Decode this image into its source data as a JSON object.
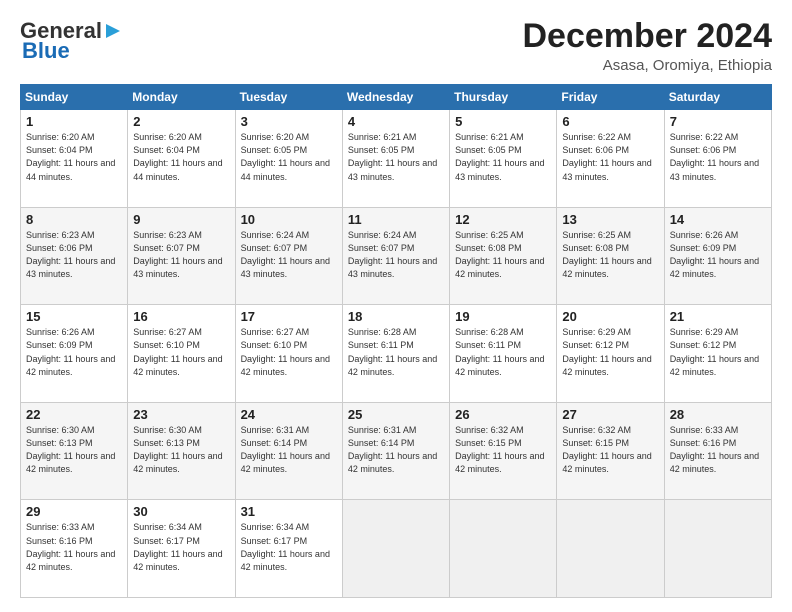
{
  "header": {
    "logo_line1": "General",
    "logo_line2": "Blue",
    "month": "December 2024",
    "location": "Asasa, Oromiya, Ethiopia"
  },
  "days_of_week": [
    "Sunday",
    "Monday",
    "Tuesday",
    "Wednesday",
    "Thursday",
    "Friday",
    "Saturday"
  ],
  "weeks": [
    [
      {
        "day": "1",
        "sunrise": "6:20 AM",
        "sunset": "6:04 PM",
        "daylight": "11 hours and 44 minutes."
      },
      {
        "day": "2",
        "sunrise": "6:20 AM",
        "sunset": "6:04 PM",
        "daylight": "11 hours and 44 minutes."
      },
      {
        "day": "3",
        "sunrise": "6:20 AM",
        "sunset": "6:05 PM",
        "daylight": "11 hours and 44 minutes."
      },
      {
        "day": "4",
        "sunrise": "6:21 AM",
        "sunset": "6:05 PM",
        "daylight": "11 hours and 43 minutes."
      },
      {
        "day": "5",
        "sunrise": "6:21 AM",
        "sunset": "6:05 PM",
        "daylight": "11 hours and 43 minutes."
      },
      {
        "day": "6",
        "sunrise": "6:22 AM",
        "sunset": "6:06 PM",
        "daylight": "11 hours and 43 minutes."
      },
      {
        "day": "7",
        "sunrise": "6:22 AM",
        "sunset": "6:06 PM",
        "daylight": "11 hours and 43 minutes."
      }
    ],
    [
      {
        "day": "8",
        "sunrise": "6:23 AM",
        "sunset": "6:06 PM",
        "daylight": "11 hours and 43 minutes."
      },
      {
        "day": "9",
        "sunrise": "6:23 AM",
        "sunset": "6:07 PM",
        "daylight": "11 hours and 43 minutes."
      },
      {
        "day": "10",
        "sunrise": "6:24 AM",
        "sunset": "6:07 PM",
        "daylight": "11 hours and 43 minutes."
      },
      {
        "day": "11",
        "sunrise": "6:24 AM",
        "sunset": "6:07 PM",
        "daylight": "11 hours and 43 minutes."
      },
      {
        "day": "12",
        "sunrise": "6:25 AM",
        "sunset": "6:08 PM",
        "daylight": "11 hours and 42 minutes."
      },
      {
        "day": "13",
        "sunrise": "6:25 AM",
        "sunset": "6:08 PM",
        "daylight": "11 hours and 42 minutes."
      },
      {
        "day": "14",
        "sunrise": "6:26 AM",
        "sunset": "6:09 PM",
        "daylight": "11 hours and 42 minutes."
      }
    ],
    [
      {
        "day": "15",
        "sunrise": "6:26 AM",
        "sunset": "6:09 PM",
        "daylight": "11 hours and 42 minutes."
      },
      {
        "day": "16",
        "sunrise": "6:27 AM",
        "sunset": "6:10 PM",
        "daylight": "11 hours and 42 minutes."
      },
      {
        "day": "17",
        "sunrise": "6:27 AM",
        "sunset": "6:10 PM",
        "daylight": "11 hours and 42 minutes."
      },
      {
        "day": "18",
        "sunrise": "6:28 AM",
        "sunset": "6:11 PM",
        "daylight": "11 hours and 42 minutes."
      },
      {
        "day": "19",
        "sunrise": "6:28 AM",
        "sunset": "6:11 PM",
        "daylight": "11 hours and 42 minutes."
      },
      {
        "day": "20",
        "sunrise": "6:29 AM",
        "sunset": "6:12 PM",
        "daylight": "11 hours and 42 minutes."
      },
      {
        "day": "21",
        "sunrise": "6:29 AM",
        "sunset": "6:12 PM",
        "daylight": "11 hours and 42 minutes."
      }
    ],
    [
      {
        "day": "22",
        "sunrise": "6:30 AM",
        "sunset": "6:13 PM",
        "daylight": "11 hours and 42 minutes."
      },
      {
        "day": "23",
        "sunrise": "6:30 AM",
        "sunset": "6:13 PM",
        "daylight": "11 hours and 42 minutes."
      },
      {
        "day": "24",
        "sunrise": "6:31 AM",
        "sunset": "6:14 PM",
        "daylight": "11 hours and 42 minutes."
      },
      {
        "day": "25",
        "sunrise": "6:31 AM",
        "sunset": "6:14 PM",
        "daylight": "11 hours and 42 minutes."
      },
      {
        "day": "26",
        "sunrise": "6:32 AM",
        "sunset": "6:15 PM",
        "daylight": "11 hours and 42 minutes."
      },
      {
        "day": "27",
        "sunrise": "6:32 AM",
        "sunset": "6:15 PM",
        "daylight": "11 hours and 42 minutes."
      },
      {
        "day": "28",
        "sunrise": "6:33 AM",
        "sunset": "6:16 PM",
        "daylight": "11 hours and 42 minutes."
      }
    ],
    [
      {
        "day": "29",
        "sunrise": "6:33 AM",
        "sunset": "6:16 PM",
        "daylight": "11 hours and 42 minutes."
      },
      {
        "day": "30",
        "sunrise": "6:34 AM",
        "sunset": "6:17 PM",
        "daylight": "11 hours and 42 minutes."
      },
      {
        "day": "31",
        "sunrise": "6:34 AM",
        "sunset": "6:17 PM",
        "daylight": "11 hours and 42 minutes."
      },
      null,
      null,
      null,
      null
    ]
  ],
  "labels": {
    "sunrise": "Sunrise:",
    "sunset": "Sunset:",
    "daylight": "Daylight:"
  }
}
